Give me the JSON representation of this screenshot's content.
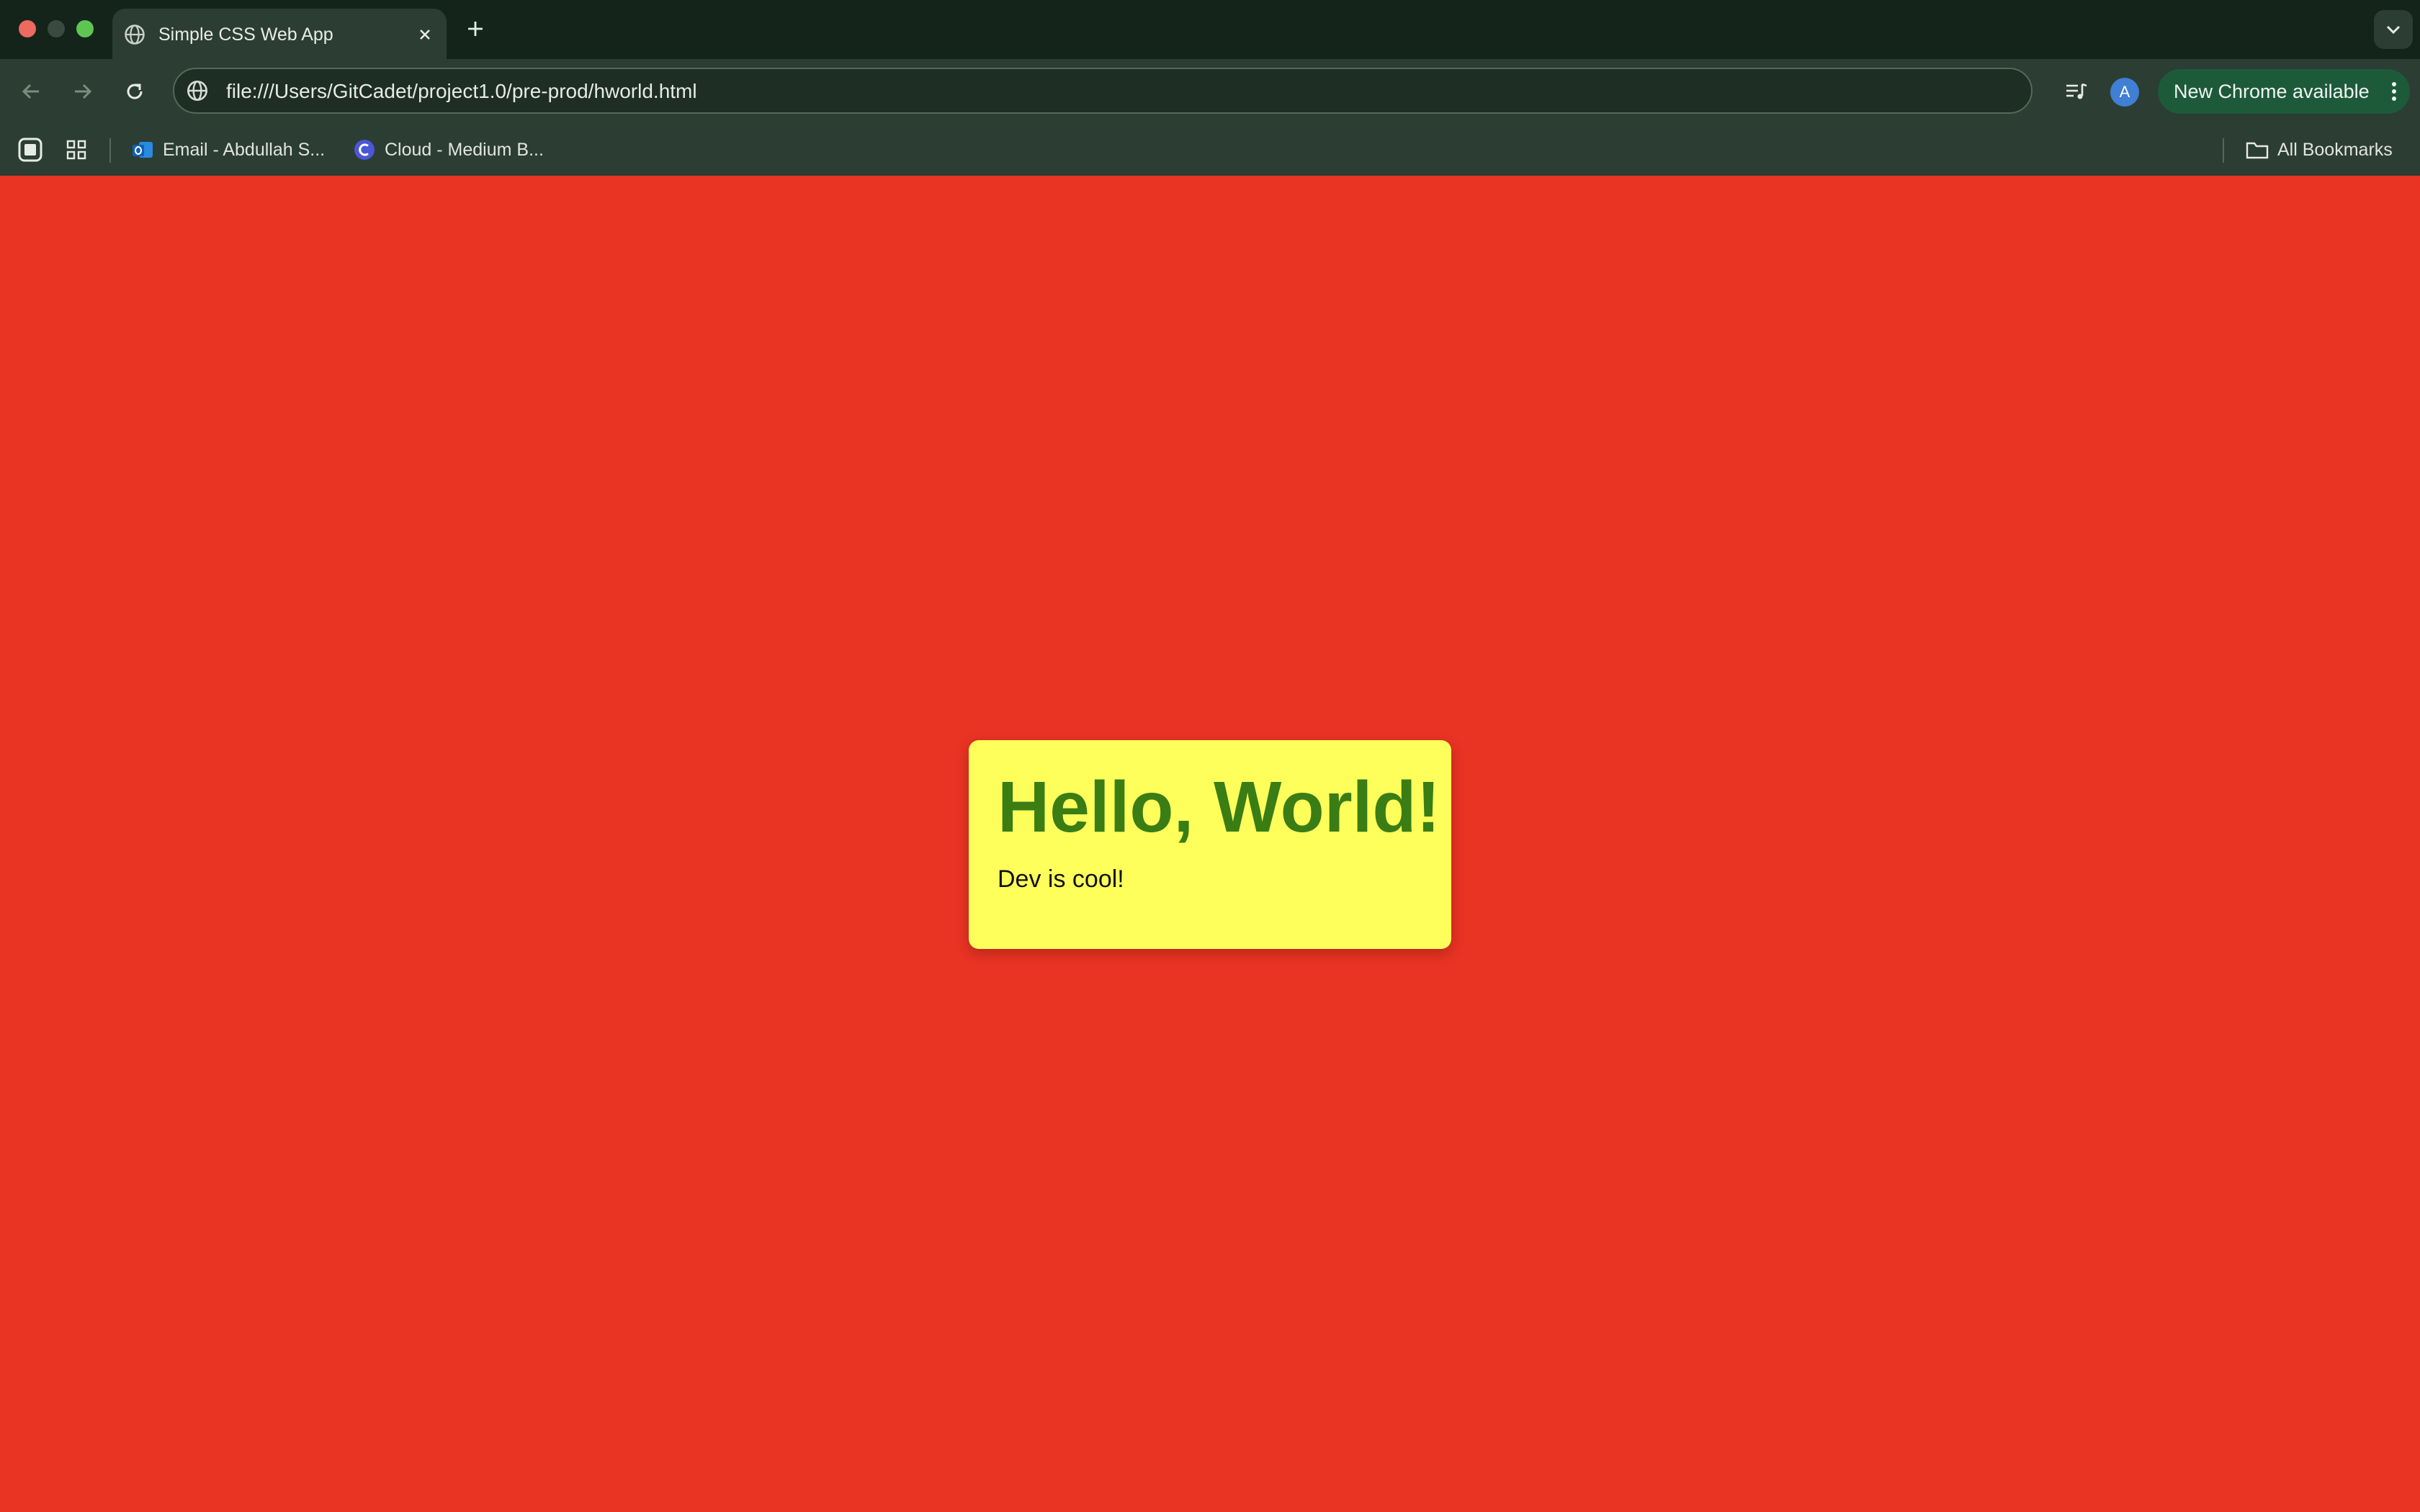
{
  "browser": {
    "tab": {
      "title": "Simple CSS Web App",
      "icon": "globe-icon"
    },
    "address_bar": {
      "url": "file:///Users/GitCadet/project1.0/pre-prod/hworld.html"
    },
    "profile": {
      "initial": "A"
    },
    "update_chip": {
      "label": "New Chrome available"
    },
    "bookmarks": {
      "items": [
        {
          "label": "Email - Abdullah S...",
          "icon": "outlook-icon"
        },
        {
          "label": "Cloud - Medium B...",
          "icon": "c-logo-icon"
        }
      ],
      "all_bookmarks_label": "All Bookmarks"
    }
  },
  "page": {
    "background_color": "#e93323",
    "card": {
      "heading": "Hello, World!",
      "text": "Dev is cool!",
      "background_color": "#ffff5c",
      "heading_color": "#3a7d14"
    }
  }
}
